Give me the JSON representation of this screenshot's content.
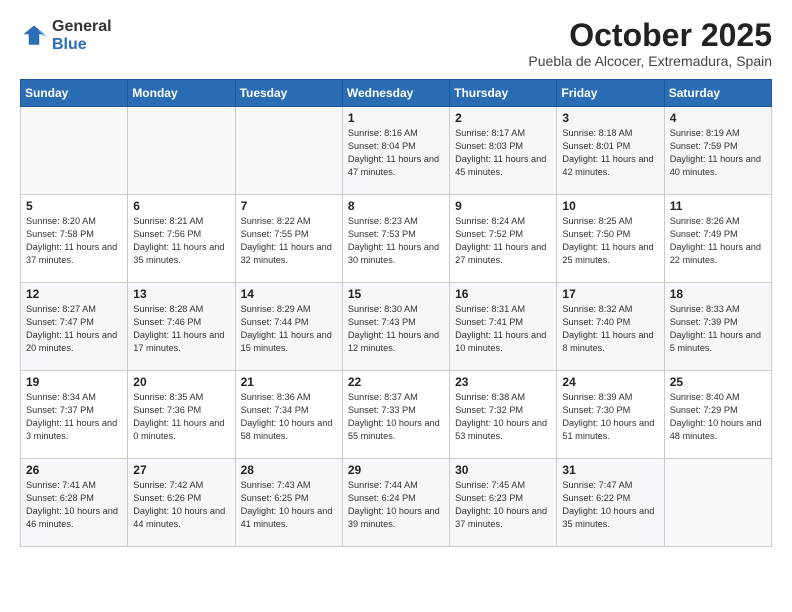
{
  "logo": {
    "general": "General",
    "blue": "Blue"
  },
  "title": "October 2025",
  "subtitle": "Puebla de Alcocer, Extremadura, Spain",
  "weekdays": [
    "Sunday",
    "Monday",
    "Tuesday",
    "Wednesday",
    "Thursday",
    "Friday",
    "Saturday"
  ],
  "weeks": [
    [
      {
        "day": "",
        "info": ""
      },
      {
        "day": "",
        "info": ""
      },
      {
        "day": "",
        "info": ""
      },
      {
        "day": "1",
        "info": "Sunrise: 8:16 AM\nSunset: 8:04 PM\nDaylight: 11 hours and 47 minutes."
      },
      {
        "day": "2",
        "info": "Sunrise: 8:17 AM\nSunset: 8:03 PM\nDaylight: 11 hours and 45 minutes."
      },
      {
        "day": "3",
        "info": "Sunrise: 8:18 AM\nSunset: 8:01 PM\nDaylight: 11 hours and 42 minutes."
      },
      {
        "day": "4",
        "info": "Sunrise: 8:19 AM\nSunset: 7:59 PM\nDaylight: 11 hours and 40 minutes."
      }
    ],
    [
      {
        "day": "5",
        "info": "Sunrise: 8:20 AM\nSunset: 7:58 PM\nDaylight: 11 hours and 37 minutes."
      },
      {
        "day": "6",
        "info": "Sunrise: 8:21 AM\nSunset: 7:56 PM\nDaylight: 11 hours and 35 minutes."
      },
      {
        "day": "7",
        "info": "Sunrise: 8:22 AM\nSunset: 7:55 PM\nDaylight: 11 hours and 32 minutes."
      },
      {
        "day": "8",
        "info": "Sunrise: 8:23 AM\nSunset: 7:53 PM\nDaylight: 11 hours and 30 minutes."
      },
      {
        "day": "9",
        "info": "Sunrise: 8:24 AM\nSunset: 7:52 PM\nDaylight: 11 hours and 27 minutes."
      },
      {
        "day": "10",
        "info": "Sunrise: 8:25 AM\nSunset: 7:50 PM\nDaylight: 11 hours and 25 minutes."
      },
      {
        "day": "11",
        "info": "Sunrise: 8:26 AM\nSunset: 7:49 PM\nDaylight: 11 hours and 22 minutes."
      }
    ],
    [
      {
        "day": "12",
        "info": "Sunrise: 8:27 AM\nSunset: 7:47 PM\nDaylight: 11 hours and 20 minutes."
      },
      {
        "day": "13",
        "info": "Sunrise: 8:28 AM\nSunset: 7:46 PM\nDaylight: 11 hours and 17 minutes."
      },
      {
        "day": "14",
        "info": "Sunrise: 8:29 AM\nSunset: 7:44 PM\nDaylight: 11 hours and 15 minutes."
      },
      {
        "day": "15",
        "info": "Sunrise: 8:30 AM\nSunset: 7:43 PM\nDaylight: 11 hours and 12 minutes."
      },
      {
        "day": "16",
        "info": "Sunrise: 8:31 AM\nSunset: 7:41 PM\nDaylight: 11 hours and 10 minutes."
      },
      {
        "day": "17",
        "info": "Sunrise: 8:32 AM\nSunset: 7:40 PM\nDaylight: 11 hours and 8 minutes."
      },
      {
        "day": "18",
        "info": "Sunrise: 8:33 AM\nSunset: 7:39 PM\nDaylight: 11 hours and 5 minutes."
      }
    ],
    [
      {
        "day": "19",
        "info": "Sunrise: 8:34 AM\nSunset: 7:37 PM\nDaylight: 11 hours and 3 minutes."
      },
      {
        "day": "20",
        "info": "Sunrise: 8:35 AM\nSunset: 7:36 PM\nDaylight: 11 hours and 0 minutes."
      },
      {
        "day": "21",
        "info": "Sunrise: 8:36 AM\nSunset: 7:34 PM\nDaylight: 10 hours and 58 minutes."
      },
      {
        "day": "22",
        "info": "Sunrise: 8:37 AM\nSunset: 7:33 PM\nDaylight: 10 hours and 55 minutes."
      },
      {
        "day": "23",
        "info": "Sunrise: 8:38 AM\nSunset: 7:32 PM\nDaylight: 10 hours and 53 minutes."
      },
      {
        "day": "24",
        "info": "Sunrise: 8:39 AM\nSunset: 7:30 PM\nDaylight: 10 hours and 51 minutes."
      },
      {
        "day": "25",
        "info": "Sunrise: 8:40 AM\nSunset: 7:29 PM\nDaylight: 10 hours and 48 minutes."
      }
    ],
    [
      {
        "day": "26",
        "info": "Sunrise: 7:41 AM\nSunset: 6:28 PM\nDaylight: 10 hours and 46 minutes."
      },
      {
        "day": "27",
        "info": "Sunrise: 7:42 AM\nSunset: 6:26 PM\nDaylight: 10 hours and 44 minutes."
      },
      {
        "day": "28",
        "info": "Sunrise: 7:43 AM\nSunset: 6:25 PM\nDaylight: 10 hours and 41 minutes."
      },
      {
        "day": "29",
        "info": "Sunrise: 7:44 AM\nSunset: 6:24 PM\nDaylight: 10 hours and 39 minutes."
      },
      {
        "day": "30",
        "info": "Sunrise: 7:45 AM\nSunset: 6:23 PM\nDaylight: 10 hours and 37 minutes."
      },
      {
        "day": "31",
        "info": "Sunrise: 7:47 AM\nSunset: 6:22 PM\nDaylight: 10 hours and 35 minutes."
      },
      {
        "day": "",
        "info": ""
      }
    ]
  ]
}
